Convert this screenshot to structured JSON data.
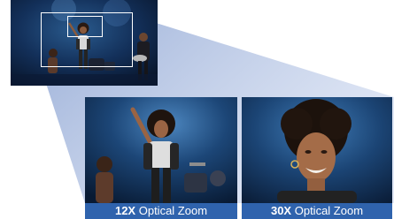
{
  "captions": [
    {
      "strong": "12X",
      "text": " Optical Zoom"
    },
    {
      "strong": "30X",
      "text": " Optical Zoom"
    }
  ],
  "colors": {
    "caption_bg": "#2f63ad",
    "cone": "#9aaed6",
    "stage_bg": "#0b1a34"
  }
}
